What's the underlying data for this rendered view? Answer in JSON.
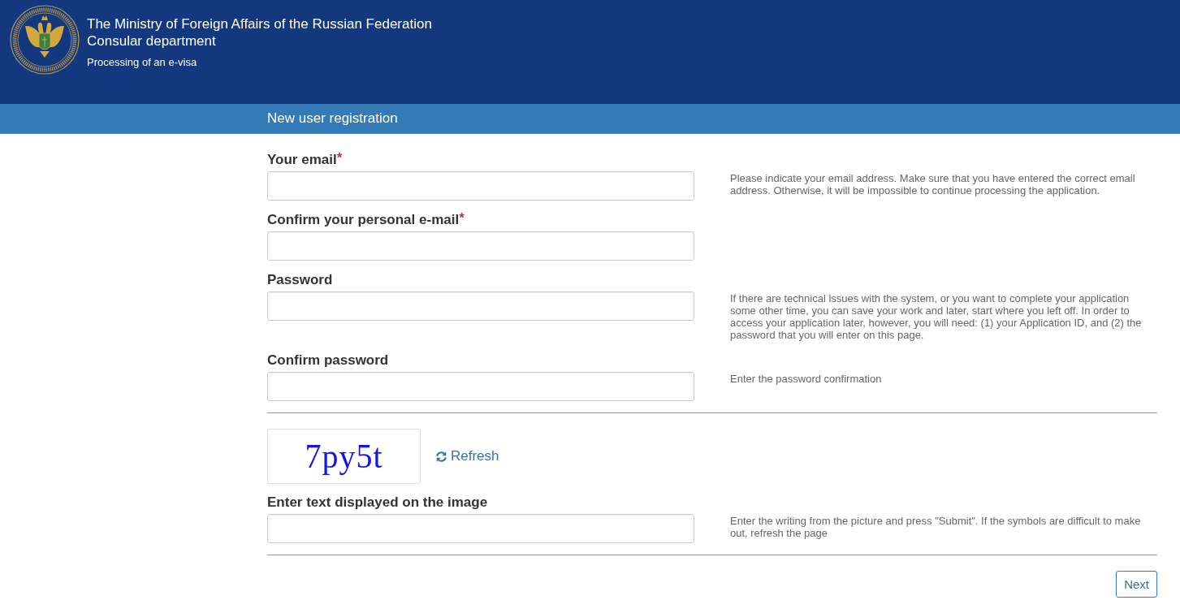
{
  "header": {
    "title": "The Ministry of Foreign Affairs of the Russian Federation",
    "department": "Consular department",
    "subtitle": "Processing of an e-visa"
  },
  "section_bar": {
    "title": "New user registration"
  },
  "fields": [
    {
      "label": "Your email",
      "required_mark": "*",
      "help": "Please indicate your email address. Make sure that you have entered the correct email address. Otherwise, it will be impossible to continue processing the application."
    },
    {
      "label": "Confirm your personal e-mail",
      "required_mark": "*"
    },
    {
      "label": "Password",
      "help": "If there are technical issues with the system, or you want to complete your application some other time, you can save your work and later, start where you left off. In order to access your application later, however, you will need: (1) your Application ID, and (2) the password that you will enter on this page."
    },
    {
      "label": "Confirm password",
      "help": "Enter the password confirmation"
    }
  ],
  "captcha": {
    "image_text": "7py5t",
    "refresh_link": "Refresh",
    "entry": {
      "label": "Enter text displayed on the image",
      "help": "Enter the writing from the picture and press \"Submit\". If the symbols are difficult to make out, refresh the page"
    }
  },
  "buttons": [
    "Next"
  ]
}
